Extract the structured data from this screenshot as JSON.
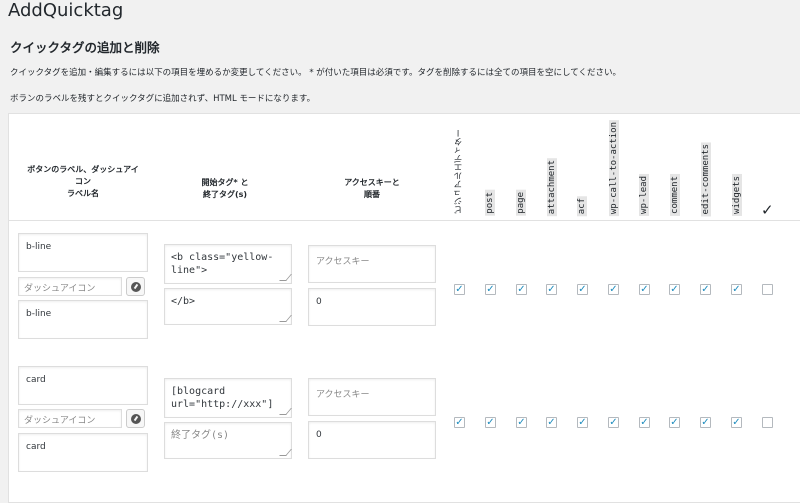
{
  "app_title": "AddQuicktag",
  "section_title": "クイックタグの追加と削除",
  "description_line1": "クイックタグを追加・編集するには以下の項目を埋めるか変更してください。 * が付いた項目は必須です。タグを削除するには全ての項目を空にしてください。",
  "description_line2": "ボランのラベルを残すとクイックタグに追加されず、HTML モードになります。",
  "headers": {
    "label_line1": "ボタンのラベル、ダッシュアイ",
    "label_line2": "コン",
    "label_line3": "ラベル名",
    "open_line1": "開始タグ* と",
    "open_line2": "終了タグ(s)",
    "key_line1": "アクセスキーと",
    "key_line2": "順番",
    "check_all": "✓",
    "columns": [
      "ビジュアルエディター",
      "post",
      "page",
      "attachment",
      "acf",
      "wp-call-to-action",
      "wp-lead",
      "comment",
      "edit-comments",
      "widgets"
    ]
  },
  "rows": [
    {
      "button_label": "b-line",
      "dashicon_placeholder": "ダッシュアイコン",
      "title": "b-line",
      "start_tag": "<b class=\"yellow-\nline\">",
      "end_tag": "</b>",
      "access_key_placeholder": "アクセスキー",
      "order": "0",
      "checks": [
        true,
        true,
        true,
        true,
        true,
        true,
        true,
        true,
        true,
        true,
        false
      ]
    },
    {
      "button_label": "card",
      "dashicon_placeholder": "ダッシュアイコン",
      "title": "card",
      "start_tag": "[blogcard\nurl=\"http://xxx\"]",
      "end_tag_placeholder": "終了タグ(s)",
      "access_key_placeholder": "アクセスキー",
      "order": "0",
      "checks": [
        true,
        true,
        true,
        true,
        true,
        true,
        true,
        true,
        true,
        true,
        false
      ]
    }
  ],
  "colors": {
    "background": "#f1f1f1",
    "checkmark": "#1e8cbe",
    "label_bg": "#e5e5e5"
  }
}
